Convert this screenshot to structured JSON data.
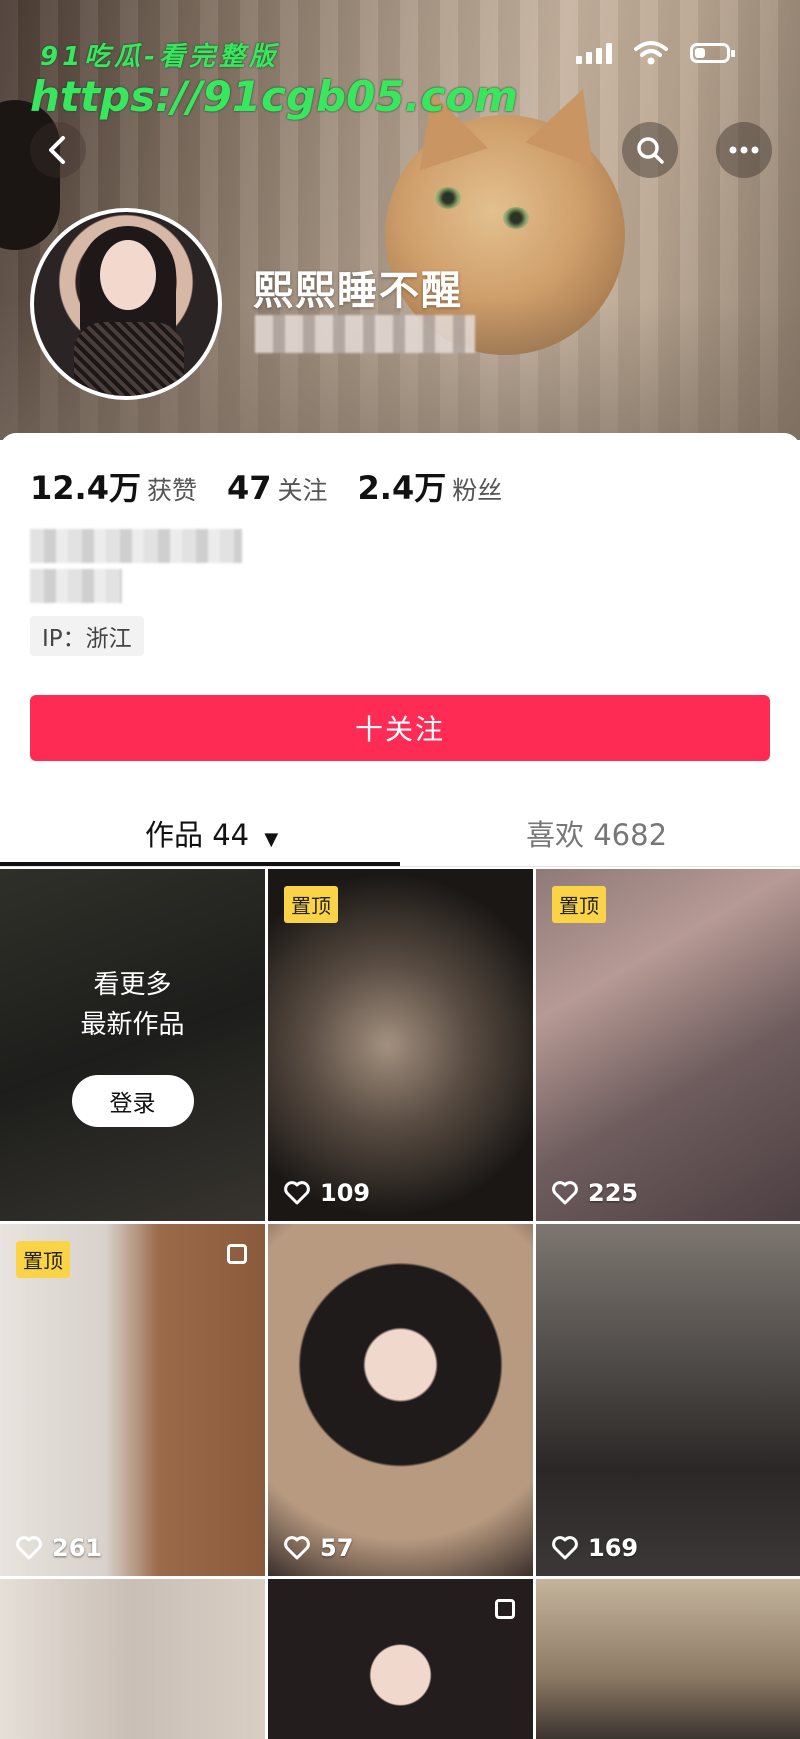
{
  "watermark": {
    "line1": "91吃瓜-看完整版",
    "line2": "https://91cgb05.com"
  },
  "status": {
    "signal_bars": 4,
    "battery_level": 0.3
  },
  "nav": {
    "back_label": "‹",
    "search_icon": "search-icon",
    "more_label": "•••"
  },
  "profile": {
    "name": "熙熙睡不醒"
  },
  "stats": [
    {
      "num": "12.4万",
      "label": "获赞"
    },
    {
      "num": "47",
      "label": "关注"
    },
    {
      "num": "2.4万",
      "label": "粉丝"
    }
  ],
  "ip": "IP：浙江",
  "follow_button": "十关注",
  "tabs": {
    "works_label": "作品 44",
    "works_caret": "▼",
    "likes_label": "喜欢 4682"
  },
  "grid": {
    "more_line1": "看更多",
    "more_line2": "最新作品",
    "login_label": "登录",
    "pin_label": "置顶",
    "items": [
      {
        "likes": "109",
        "pinned": true
      },
      {
        "likes": "225",
        "pinned": true
      },
      {
        "likes": "261",
        "pinned": true
      },
      {
        "likes": "57",
        "pinned": false
      },
      {
        "likes": "169",
        "pinned": false
      }
    ]
  },
  "colors": {
    "accent": "#fe2c55",
    "pin": "#fbd347",
    "watermark": "#39e75f"
  }
}
